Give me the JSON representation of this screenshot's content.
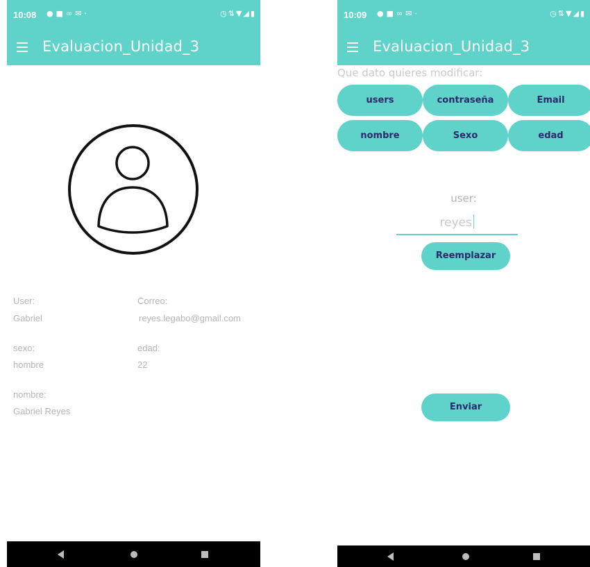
{
  "left_screen": {
    "status": {
      "time": "10:08"
    },
    "app_title": "Evaluacion_Unidad_3",
    "profile": {
      "user_label": "User:",
      "user_value": "Gabriel",
      "email_label": "Correo:",
      "email_value": "reyes.legabo@gmail.com",
      "sex_label": "sexo:",
      "sex_value": "hombre",
      "age_label": "edad:",
      "age_value": "22",
      "name_label": "nombre:",
      "name_value": "Gabriel Reyes"
    }
  },
  "right_screen": {
    "status": {
      "time": "10:09"
    },
    "app_title": "Evaluacion_Unidad_3",
    "prompt": "Que dato quieres modificar:",
    "options": [
      "users",
      "contraseña",
      "Email",
      "nombre",
      "Sexo",
      "edad"
    ],
    "field_label": "user:",
    "field_value": "reyes",
    "replace_button": "Reemplazar",
    "send_button": "Enviar"
  },
  "colors": {
    "accent": "#5fd3ca",
    "button_text": "#2a2a6b",
    "muted_text": "#b5b5b5",
    "navbar": "#000000"
  },
  "icons": {
    "status_left": [
      "facebook-icon",
      "youtube-icon",
      "link-icon",
      "gmail-icon",
      "dot-icon"
    ],
    "status_right": [
      "alarm-icon",
      "signal-data-icon",
      "wifi-icon",
      "cell-signal-icon",
      "battery-icon"
    ],
    "nav": [
      "back-icon",
      "home-icon",
      "recents-icon"
    ]
  }
}
